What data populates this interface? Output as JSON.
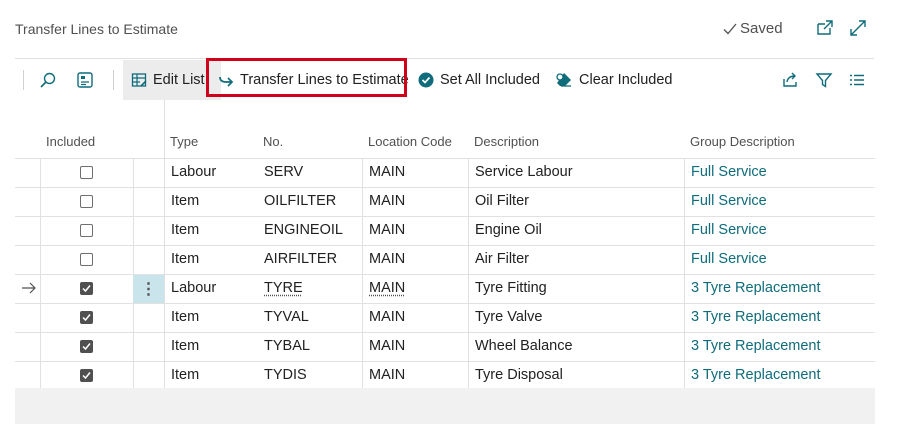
{
  "header": {
    "title": "Transfer Lines to Estimate",
    "saved_label": "Saved"
  },
  "actions": {
    "edit_list": "Edit List",
    "transfer": "Transfer Lines to Estimate",
    "set_all": "Set All Included",
    "clear": "Clear Included"
  },
  "columns": {
    "included": "Included",
    "type": "Type",
    "no": "No.",
    "location": "Location Code",
    "description": "Description",
    "group": "Group Description"
  },
  "rows": [
    {
      "included": false,
      "type": "Labour",
      "no": "SERV",
      "location": "MAIN",
      "description": "Service Labour",
      "group": "Full Service"
    },
    {
      "included": false,
      "type": "Item",
      "no": "OILFILTER",
      "location": "MAIN",
      "description": "Oil Filter",
      "group": "Full Service"
    },
    {
      "included": false,
      "type": "Item",
      "no": "ENGINEOIL",
      "location": "MAIN",
      "description": "Engine Oil",
      "group": "Full Service"
    },
    {
      "included": false,
      "type": "Item",
      "no": "AIRFILTER",
      "location": "MAIN",
      "description": "Air Filter",
      "group": "Full Service"
    },
    {
      "included": true,
      "type": "Labour",
      "no": "TYRE",
      "location": "MAIN",
      "description": "Tyre Fitting",
      "group": "3 Tyre Replacement",
      "selected": true
    },
    {
      "included": true,
      "type": "Item",
      "no": "TYVAL",
      "location": "MAIN",
      "description": "Tyre Valve",
      "group": "3 Tyre Replacement"
    },
    {
      "included": true,
      "type": "Item",
      "no": "TYBAL",
      "location": "MAIN",
      "description": "Wheel Balance",
      "group": "3 Tyre Replacement"
    },
    {
      "included": true,
      "type": "Item",
      "no": "TYDIS",
      "location": "MAIN",
      "description": "Tyre Disposal",
      "group": "3 Tyre Replacement"
    }
  ],
  "colors": {
    "accent": "#0f6c7b",
    "highlight_border": "#d0021b",
    "selected_cell": "#c9e4ea"
  }
}
